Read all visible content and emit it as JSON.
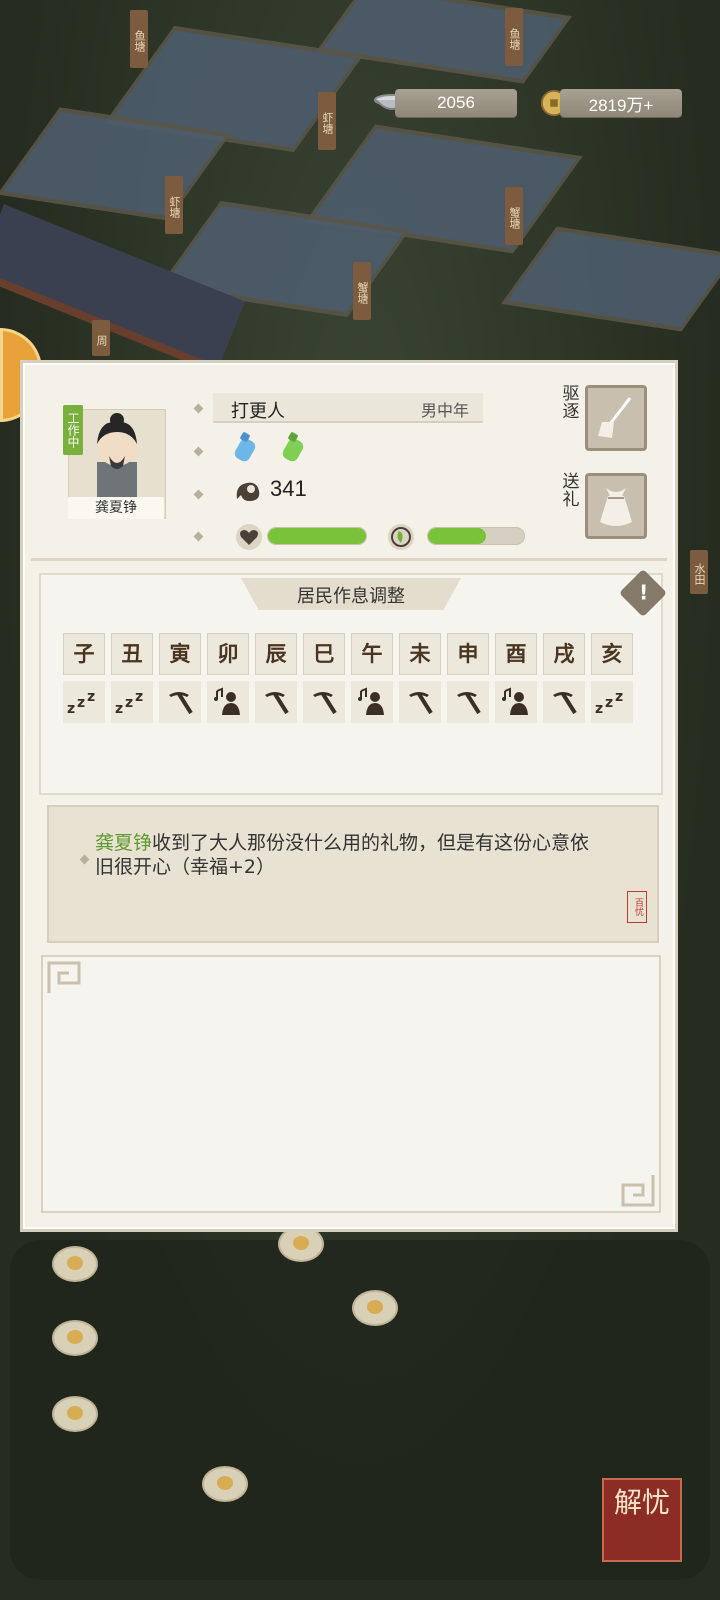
{
  "map": {
    "flags": [
      "鱼塘",
      "鱼塘",
      "虾塘",
      "虾塘",
      "蟹塘",
      "蟹塘",
      "周",
      "水田"
    ]
  },
  "currency": {
    "bowl_value": "2056",
    "coin_value": "2819万+",
    "bowl_icon": "bowl-icon",
    "coin_icon": "copper-coin-icon"
  },
  "resident": {
    "status_tag": "工作中",
    "name": "龚夏铮",
    "job": "打更人",
    "gender_age": "男中年",
    "stat_value": "341",
    "happiness_fill": 1.0,
    "health_fill": 0.6
  },
  "actions": {
    "expel_label": "驱逐",
    "gift_label": "送礼"
  },
  "schedule": {
    "title": "居民作息调整",
    "info_symbol": "!",
    "hours": [
      "子",
      "丑",
      "寅",
      "卯",
      "辰",
      "巳",
      "午",
      "未",
      "申",
      "酉",
      "戌",
      "亥"
    ],
    "activities": [
      "sleep",
      "sleep",
      "work",
      "leisure",
      "work",
      "work",
      "leisure",
      "work",
      "work",
      "leisure",
      "work",
      "sleep"
    ]
  },
  "message": {
    "name": "龚夏铮",
    "text": "收到了大人那份没什么用的礼物，但是有这份心意依旧很开心（幸福+2）",
    "seal": "百忧"
  },
  "bottom_button": {
    "label": "解忧"
  },
  "colors": {
    "accent_green": "#79c23a",
    "name_green": "#5f9a2f",
    "panel_bg": "#f4f1e9"
  }
}
